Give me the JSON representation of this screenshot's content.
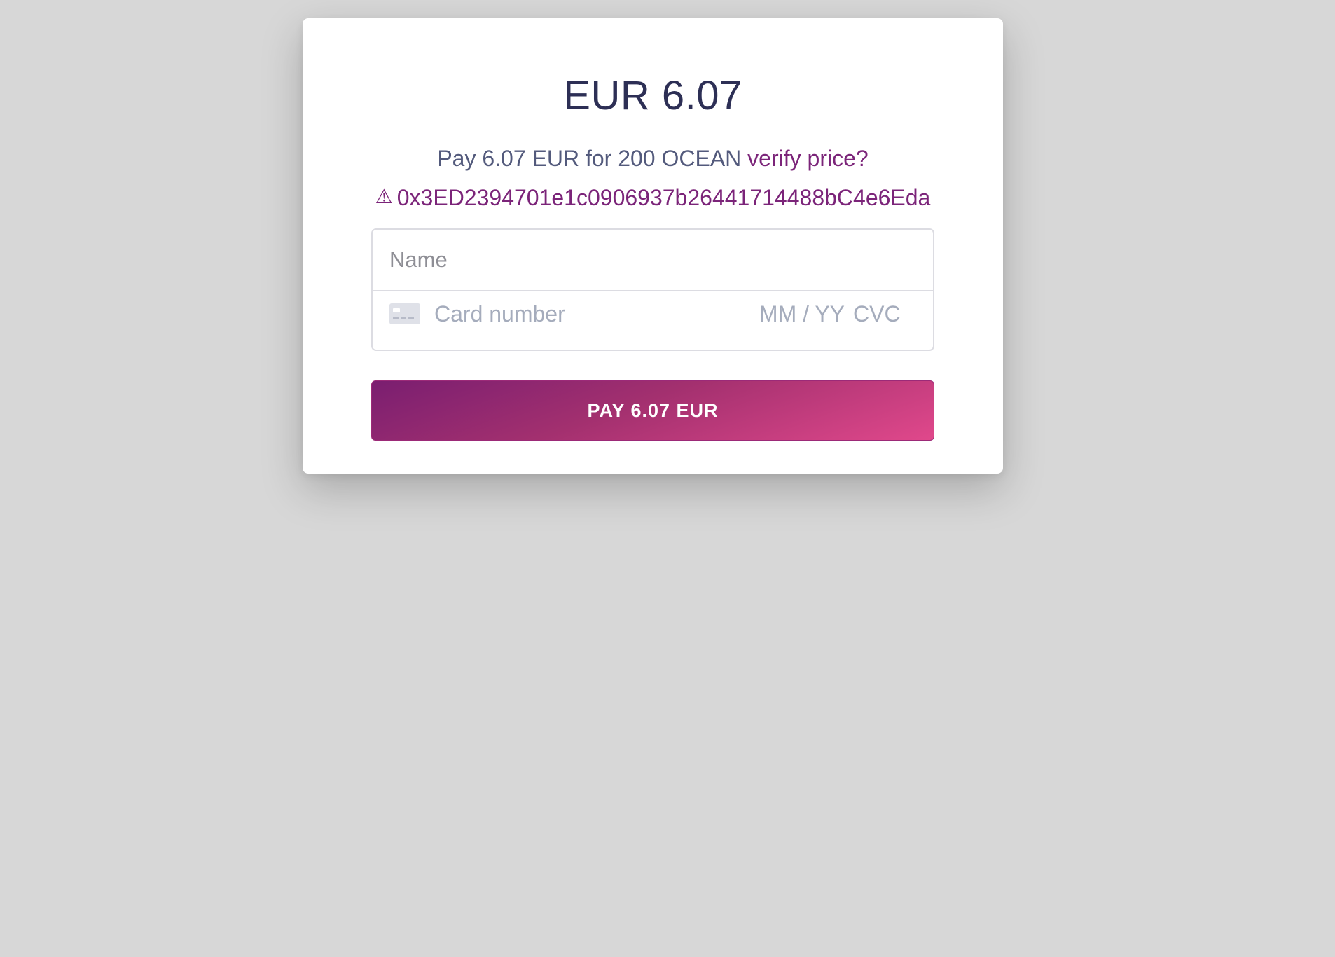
{
  "checkout": {
    "amount_title": "EUR 6.07",
    "description": "Pay 6.07 EUR for 200 OCEAN ",
    "verify_link": "verify price?",
    "warning_symbol": "⚠",
    "wallet_address": "0x3ED2394701e1c0906937b26441714488bC4e6Eda"
  },
  "form": {
    "name_placeholder": "Name",
    "card_number_placeholder": "Card number",
    "expiry_placeholder": "MM / YY",
    "cvc_placeholder": "CVC",
    "card_icon": "credit-card-icon"
  },
  "pay_button": {
    "label": "PAY 6.07 EUR"
  },
  "colors": {
    "background": "#d7d7d7",
    "title": "#2d2f55",
    "accent": "#7b2479",
    "button_gradient_start": "#7a1e70",
    "button_gradient_end": "#e0488b"
  }
}
